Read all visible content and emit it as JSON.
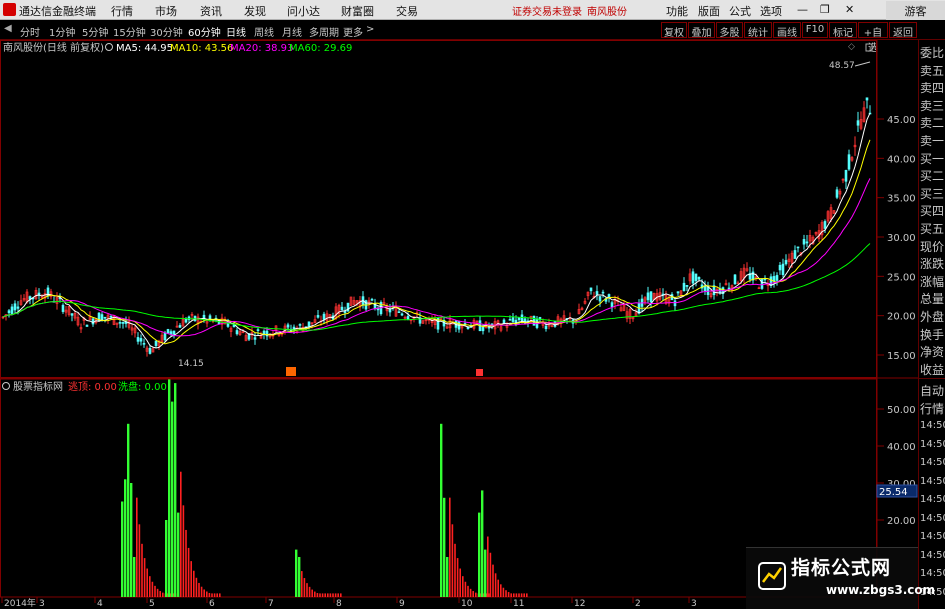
{
  "app": {
    "title": "通达信金融终端",
    "menu": [
      "行情",
      "市场",
      "资讯",
      "发现",
      "问小达",
      "财富圈",
      "交易"
    ],
    "status_text": "证券交易未登录",
    "current_stock": "南风股份",
    "right_menu": [
      "功能",
      "版面",
      "公式",
      "选项"
    ],
    "guest_label": "游客"
  },
  "toolbar": {
    "periods": [
      "分时",
      "1分钟",
      "5分钟",
      "15分钟",
      "30分钟",
      "60分钟",
      "日线",
      "周线",
      "月线",
      "多周期",
      "更多"
    ],
    "active_period": "日线",
    "right_buttons": [
      "复权",
      "叠加",
      "多股",
      "统计",
      "画线",
      "F10",
      "标记",
      "+自选",
      "返回"
    ]
  },
  "main_chart": {
    "stock_label": "南风股份(日线 前复权)",
    "ma5": "MA5: 44.95",
    "ma10": "MA10: 43.56",
    "ma20": "MA20: 38.93",
    "ma60": "MA60: 29.69",
    "price_axis": [
      "45.00",
      "40.00",
      "35.00",
      "30.00",
      "25.00",
      "20.00",
      "15.00"
    ],
    "low_label": "14.15",
    "high_label": "48.57",
    "colors": {
      "up": "#ff3232",
      "down": "#54fcfc",
      "ma5": "#ffffff",
      "ma10": "#ffff00",
      "ma20": "#ff00ff",
      "ma60": "#00ff00"
    }
  },
  "indicator": {
    "name": "股票指标网",
    "label1": "逃顶: 0.00",
    "label2": "洗盘: 0.00",
    "axis": [
      "50.00",
      "40.00",
      "30.00",
      "20.00"
    ],
    "current_value": "25.54"
  },
  "x_axis": [
    "2014年",
    "3",
    "4",
    "5",
    "6",
    "7",
    "8",
    "9",
    "10",
    "11",
    "12",
    "2",
    "3"
  ],
  "side_panel": {
    "quote_items": [
      "委比",
      "卖五",
      "卖四",
      "卖三",
      "卖二",
      "卖一",
      "买一",
      "买二",
      "买三",
      "买四",
      "买五",
      "现价",
      "涨跌",
      "涨幅",
      "总量",
      "外盘",
      "换手",
      "净资",
      "收益"
    ],
    "lower_items": [
      "自动",
      "行情"
    ],
    "times": [
      "14:50",
      "14:50",
      "14:50",
      "14:50",
      "14:50",
      "14:50",
      "14:50",
      "14:50",
      "14:50",
      "14:50"
    ]
  },
  "watermark": {
    "title": "指标公式网",
    "url": "www.zbgs3.com"
  }
}
